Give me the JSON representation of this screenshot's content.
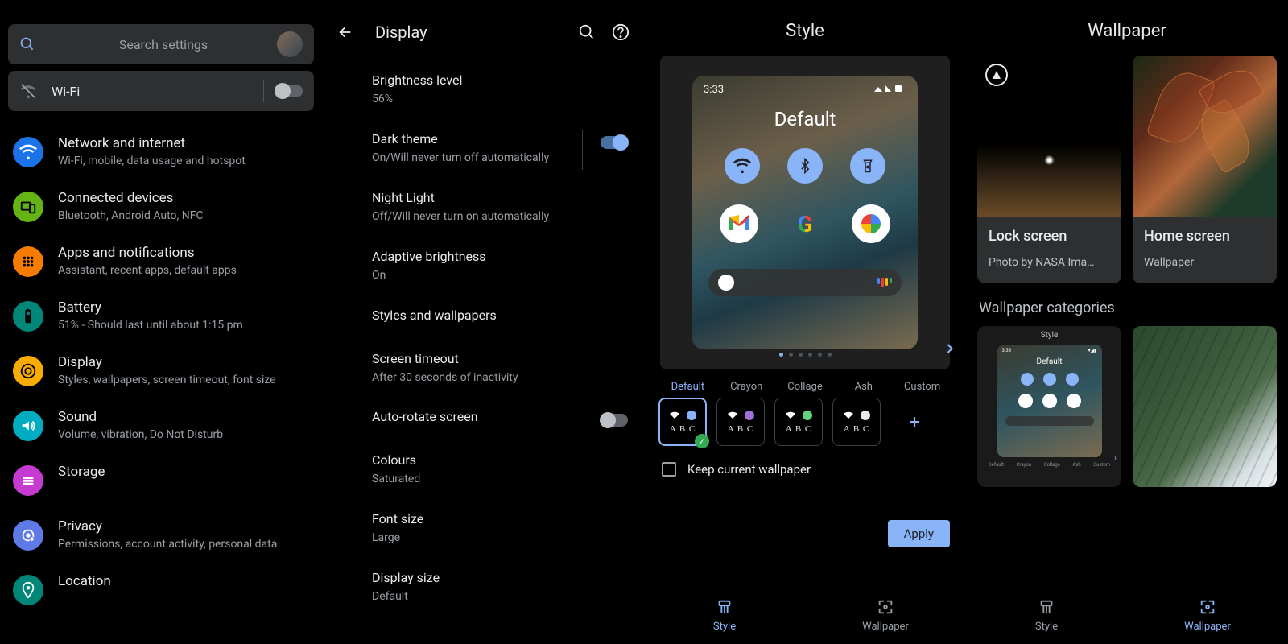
{
  "panel1": {
    "search_placeholder": "Search settings",
    "wifi_label": "Wi-Fi",
    "items": [
      {
        "title": "Network and internet",
        "sub": "Wi-Fi, mobile, data usage and hotspot",
        "color": "#1a73e8",
        "icon": "wifi"
      },
      {
        "title": "Connected devices",
        "sub": "Bluetooth, Android Auto, NFC",
        "color": "#63b414",
        "icon": "devices"
      },
      {
        "title": "Apps and notifications",
        "sub": "Assistant, recent apps, default apps",
        "color": "#f57c00",
        "icon": "apps"
      },
      {
        "title": "Battery",
        "sub": "51% - Should last until about 1:15 pm",
        "color": "#018779",
        "icon": "battery"
      },
      {
        "title": "Display",
        "sub": "Styles, wallpapers, screen timeout, font size",
        "color": "#f9ab00",
        "icon": "brightness"
      },
      {
        "title": "Sound",
        "sub": "Volume, vibration, Do Not Disturb",
        "color": "#00acc1",
        "icon": "sound"
      },
      {
        "title": "Storage",
        "sub": "",
        "color": "#c73ad1",
        "icon": "storage"
      },
      {
        "title": "Privacy",
        "sub": "Permissions, account activity, personal data",
        "color": "#5e7ae6",
        "icon": "privacy"
      },
      {
        "title": "Location",
        "sub": "",
        "color": "#018779",
        "icon": "location"
      }
    ]
  },
  "panel2": {
    "title": "Display",
    "items": [
      {
        "title": "Brightness level",
        "sub": "56%"
      },
      {
        "title": "Dark theme",
        "sub": "On/Will never turn off automatically",
        "switch": "on",
        "divider": true
      },
      {
        "title": "Night Light",
        "sub": "Off/Will never turn on automatically"
      },
      {
        "title": "Adaptive brightness",
        "sub": "On"
      },
      {
        "title": "Styles and wallpapers",
        "sub": ""
      },
      {
        "title": "Screen timeout",
        "sub": "After 30 seconds of inactivity"
      },
      {
        "title": "Auto-rotate screen",
        "sub": "",
        "switch": "off"
      },
      {
        "title": "Colours",
        "sub": "Saturated"
      },
      {
        "title": "Font size",
        "sub": "Large"
      },
      {
        "title": "Display size",
        "sub": "Default"
      }
    ]
  },
  "panel3": {
    "title": "Style",
    "preview_time": "3:33",
    "preview_label": "Default",
    "styles": [
      "Default",
      "Crayon",
      "Collage",
      "Ash",
      "Custom"
    ],
    "style_colors": [
      "#8ab4f8",
      "#a36fd9",
      "#62d37e",
      "#e8eaed"
    ],
    "abc": "A B C",
    "keep_label": "Keep current wallpaper",
    "apply": "Apply",
    "tab_style": "Style",
    "tab_wallpaper": "Wallpaper"
  },
  "panel4": {
    "title": "Wallpaper",
    "lock_title": "Lock screen",
    "lock_sub": "Photo by NASA Ima…",
    "home_title": "Home screen",
    "home_sub": "Wallpaper",
    "cats_label": "Wallpaper categories",
    "mini_title": "Style",
    "mini_time": "3:33",
    "mini_def": "Default",
    "mini_labels": [
      "Default",
      "Crayon",
      "Collage",
      "Ash",
      "Custom"
    ],
    "tab_style": "Style",
    "tab_wallpaper": "Wallpaper"
  }
}
